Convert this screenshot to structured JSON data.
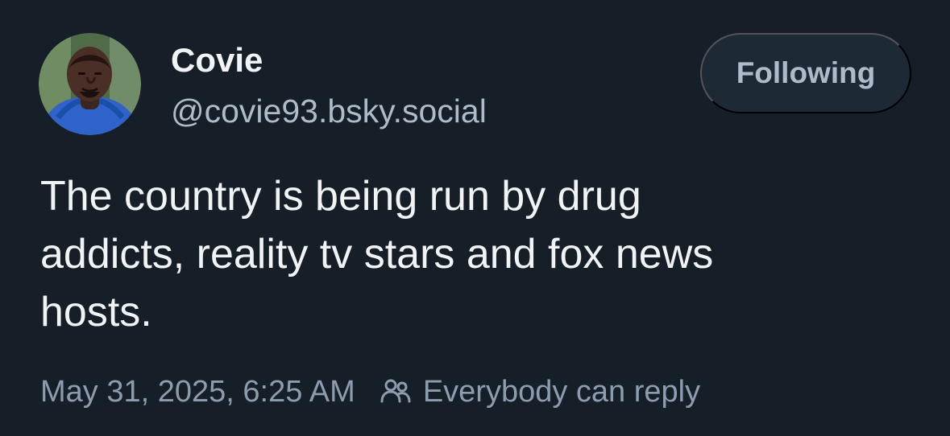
{
  "post": {
    "author": {
      "display_name": "Covie",
      "handle": "@covie93.bsky.social",
      "avatar_icon": "person-photo-avatar"
    },
    "follow_button": {
      "label": "Following"
    },
    "text": "The country is being run by drug\naddicts, reality tv stars and fox news\nhosts.",
    "timestamp": "May 31, 2025, 6:25 AM",
    "reply_setting": {
      "icon": "people-icon",
      "label": "Everybody can reply"
    }
  },
  "colors": {
    "background": "#161e27",
    "primary_text": "#f1f3f5",
    "secondary_text": "#aebbc9",
    "muted_text": "#8d9db0",
    "button_background": "#1e2936"
  }
}
